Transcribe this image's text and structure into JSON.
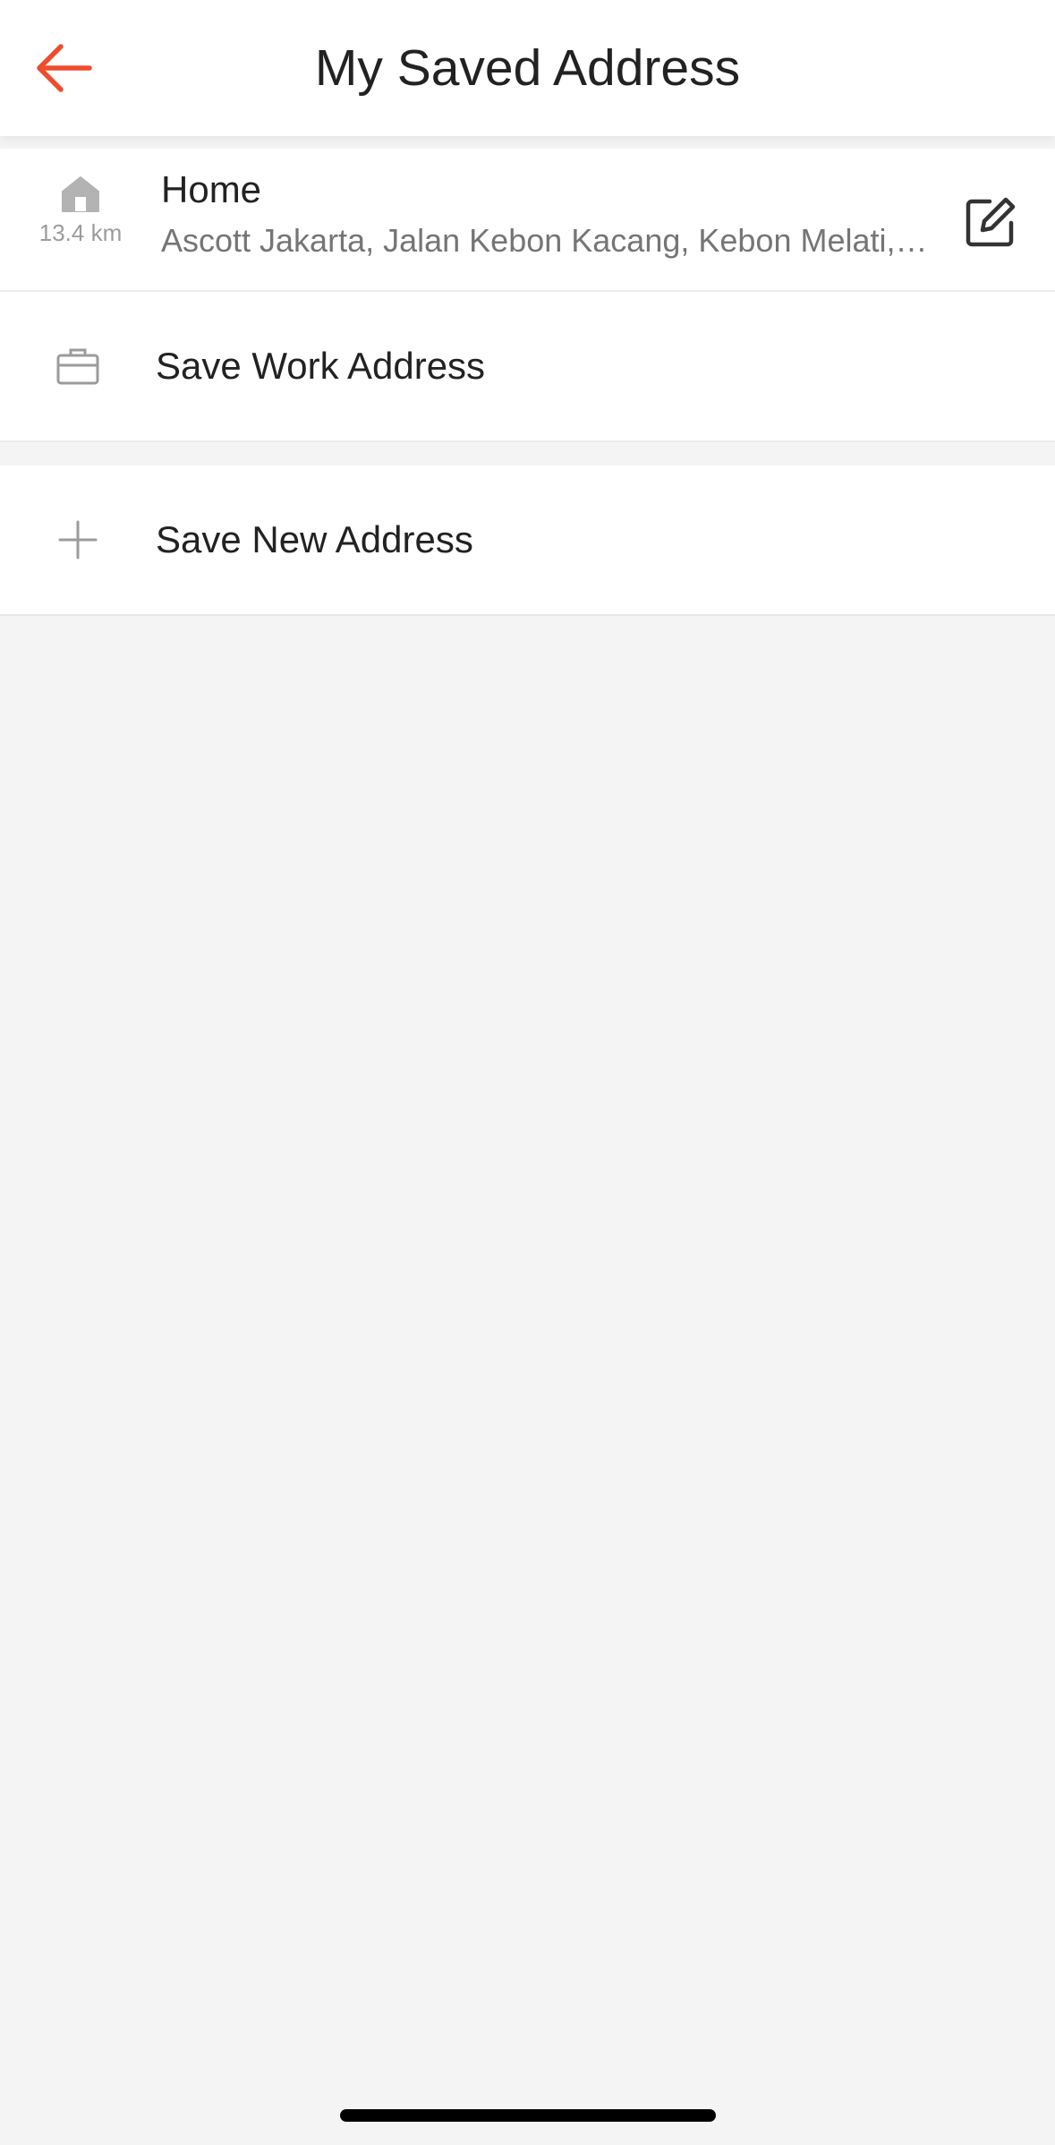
{
  "header": {
    "title": "My Saved Address",
    "back_icon": "arrow-left-icon"
  },
  "colors": {
    "accent": "#ee4d2d",
    "background": "#f4f4f4",
    "card": "#ffffff",
    "text_primary": "#222222",
    "text_secondary": "#757575",
    "icon_gray": "#9b9b9b"
  },
  "addresses": {
    "home": {
      "icon": "home-icon",
      "distance": "13.4 km",
      "label": "Home",
      "address": "Ascott Jakarta, Jalan Kebon Kacang, Kebon Melati, Tanah Abang, Central Jakarta City, Jakarta",
      "edit_icon": "edit-icon"
    },
    "work": {
      "icon": "briefcase-icon",
      "label": "Save Work Address"
    },
    "new": {
      "icon": "plus-icon",
      "label": "Save New Address"
    }
  }
}
